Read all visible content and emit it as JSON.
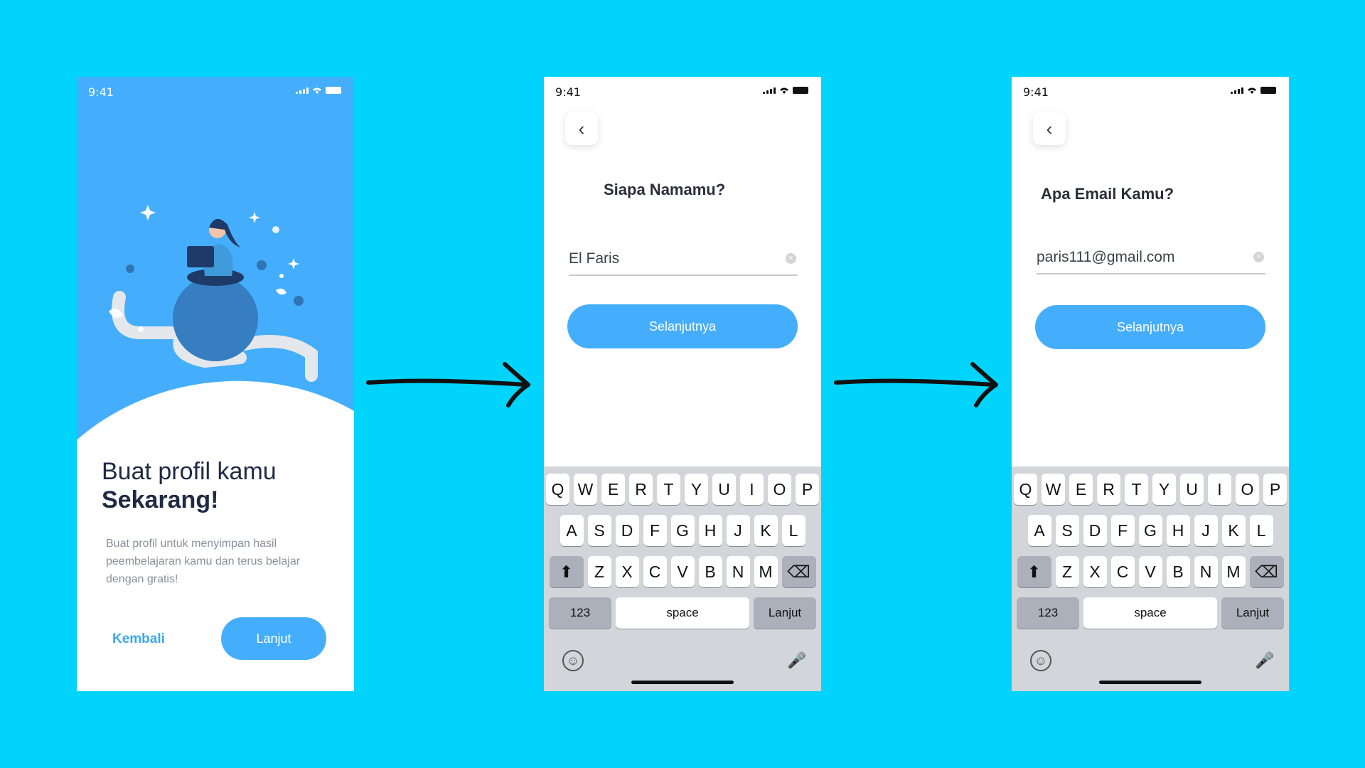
{
  "status_time": "9:41",
  "phone1": {
    "title_line1": "Buat profil kamu",
    "title_line2": "Sekarang!",
    "description": "Buat profil untuk menyimpan hasil peembelajaran kamu dan terus belajar dengan gratis!",
    "back_label": "Kembali",
    "next_label": "Lanjut"
  },
  "phone2": {
    "question": "Siapa Namamu?",
    "input_value": "El Faris",
    "next_label": "Selanjutnya"
  },
  "phone3": {
    "question": "Apa Email Kamu?",
    "input_value": "paris111@gmail.com",
    "next_label": "Selanjutnya"
  },
  "keyboard": {
    "row1": [
      "Q",
      "W",
      "E",
      "R",
      "T",
      "Y",
      "U",
      "I",
      "O",
      "P"
    ],
    "row2": [
      "A",
      "S",
      "D",
      "F",
      "G",
      "H",
      "J",
      "K",
      "L"
    ],
    "row3": [
      "Z",
      "X",
      "C",
      "V",
      "B",
      "N",
      "M"
    ],
    "num_label": "123",
    "space_label": "space",
    "return_label": "Lanjut"
  },
  "colors": {
    "background": "#00d4fc",
    "accent": "#45aefc"
  }
}
